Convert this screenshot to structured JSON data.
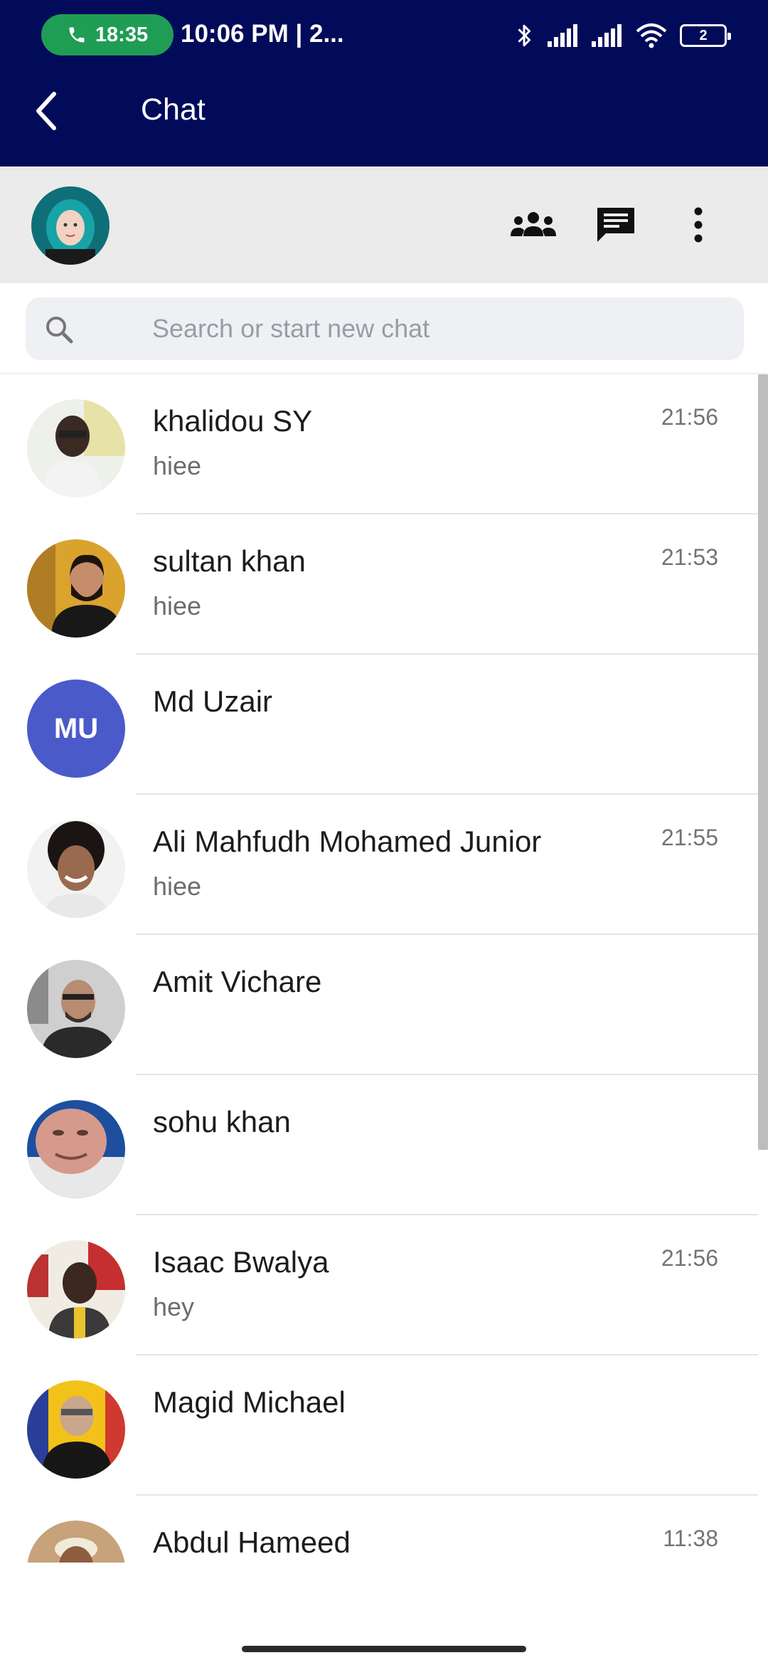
{
  "status_bar": {
    "call_timer": "18:35",
    "text": "10:06 PM |  2...",
    "battery": "2",
    "icons": [
      "bluetooth-icon",
      "signal-icon",
      "signal-icon",
      "wifi-icon",
      "battery-icon"
    ]
  },
  "app_bar": {
    "title": "Chat",
    "back_icon": "chevron-left-icon"
  },
  "header": {
    "actions": [
      "group-icon",
      "new-chat-icon",
      "more-vert-icon"
    ]
  },
  "search": {
    "placeholder": "Search or start new chat",
    "value": ""
  },
  "chats": [
    {
      "name": "khalidou SY",
      "message": "hiee",
      "time": "21:56",
      "initials": ""
    },
    {
      "name": "sultan khan",
      "message": "hiee",
      "time": "21:53",
      "initials": ""
    },
    {
      "name": "Md Uzair",
      "message": "",
      "time": "",
      "initials": "MU"
    },
    {
      "name": "Ali Mahfudh Mohamed Junior",
      "message": "hiee",
      "time": "21:55",
      "initials": ""
    },
    {
      "name": "Amit Vichare",
      "message": "",
      "time": "",
      "initials": ""
    },
    {
      "name": "sohu khan",
      "message": "",
      "time": "",
      "initials": ""
    },
    {
      "name": "Isaac Bwalya",
      "message": "hey",
      "time": "21:56",
      "initials": ""
    },
    {
      "name": "Magid Michael",
      "message": "",
      "time": "",
      "initials": ""
    },
    {
      "name": "Abdul Hameed",
      "message": "",
      "time": "11:38",
      "initials": ""
    }
  ],
  "colors": {
    "app_bar": "#020b5a",
    "call_pill": "#1f9d55",
    "initials_avatar": "#4a5ac9",
    "header_bg": "#ebebeb"
  }
}
